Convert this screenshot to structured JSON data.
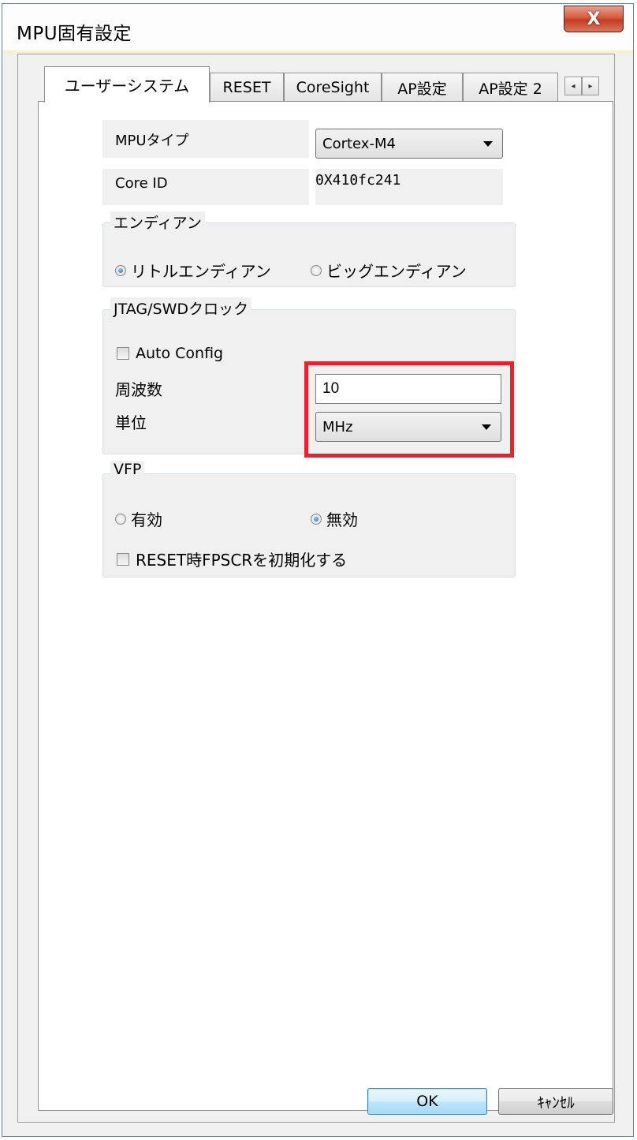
{
  "window": {
    "title": "MPU固有設定",
    "close_glyph": "X"
  },
  "tabs": [
    {
      "label": "ユーザーシステム",
      "active": true
    },
    {
      "label": "RESET",
      "active": false
    },
    {
      "label": "CoreSight",
      "active": false
    },
    {
      "label": "AP設定",
      "active": false
    },
    {
      "label": "AP設定 2",
      "active": false
    }
  ],
  "tab_scroll": {
    "left": "◂",
    "right": "▸"
  },
  "mpu": {
    "type_label": "MPUタイプ",
    "type_value": "Cortex-M4",
    "core_id_label": "Core ID",
    "core_id_value": "0X410fc241"
  },
  "endian": {
    "title": "エンディアン",
    "little_label": "リトルエンディアン",
    "big_label": "ビッグエンディアン",
    "selected": "little"
  },
  "clock": {
    "title": "JTAG/SWDクロック",
    "auto_config_label": "Auto Config",
    "auto_config_checked": false,
    "frequency_label": "周波数",
    "frequency_value": "10",
    "unit_label": "単位",
    "unit_value": "MHz"
  },
  "vfp": {
    "title": "VFP",
    "enabled_label": "有効",
    "disabled_label": "無効",
    "selected": "disabled",
    "reset_fpscr_label": "RESET時FPSCRを初期化する",
    "reset_fpscr_checked": false
  },
  "buttons": {
    "ok": "OK",
    "cancel": "ｷｬﾝｾﾙ"
  },
  "colors": {
    "highlight": "#e8212e",
    "ok_button": "#bee6fd"
  }
}
